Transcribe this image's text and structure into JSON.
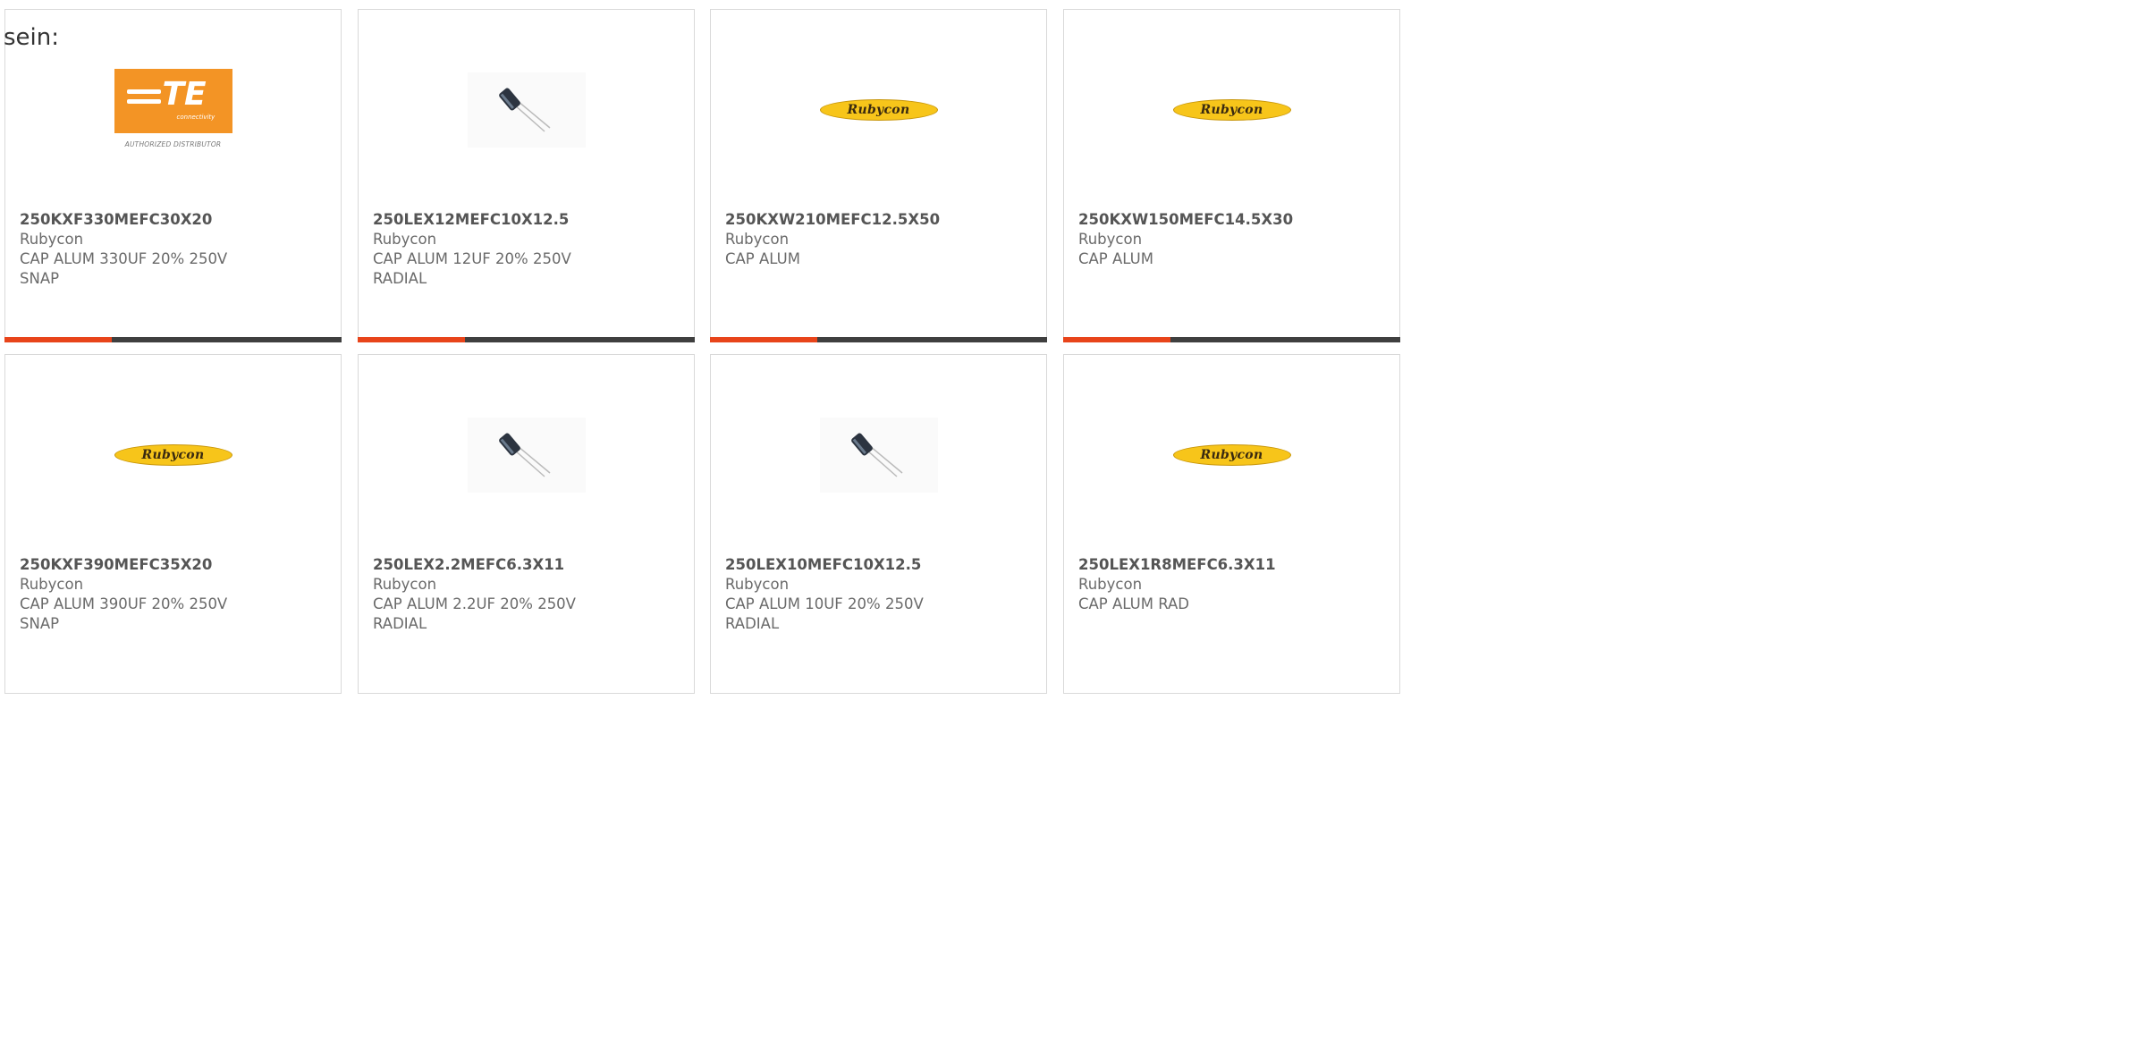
{
  "page": {
    "corner_text": "sein:"
  },
  "colors": {
    "accent": "#e8441a",
    "bar_dark": "#3f3f3f",
    "te_orange": "#f39425",
    "rubycon_yellow": "#f7c51a"
  },
  "te_logo": {
    "mark": "TE",
    "sub": "connectivity",
    "tagline": "AUTHORIZED DISTRIBUTOR"
  },
  "rubycon_logo": {
    "text": "Rubycon"
  },
  "products": [
    {
      "logo": "te-logo",
      "part": "250KXF330MEFC30X20",
      "manufacturer": "Rubycon",
      "desc_line1": "CAP ALUM 330UF 20% 250V",
      "desc_line2": "SNAP"
    },
    {
      "logo": "capacitor-image",
      "part": "250LEX12MEFC10X12.5",
      "manufacturer": "Rubycon",
      "desc_line1": "CAP ALUM 12UF 20% 250V",
      "desc_line2": "RADIAL"
    },
    {
      "logo": "rubycon-logo",
      "part": "250KXW210MEFC12.5X50",
      "manufacturer": "Rubycon",
      "desc_line1": "CAP ALUM",
      "desc_line2": ""
    },
    {
      "logo": "rubycon-logo",
      "part": "250KXW150MEFC14.5X30",
      "manufacturer": "Rubycon",
      "desc_line1": "CAP ALUM",
      "desc_line2": ""
    },
    {
      "logo": "rubycon-logo",
      "part": "250KXF390MEFC35X20",
      "manufacturer": "Rubycon",
      "desc_line1": "CAP ALUM 390UF 20% 250V",
      "desc_line2": "SNAP"
    },
    {
      "logo": "capacitor-image",
      "part": "250LEX2.2MEFC6.3X11",
      "manufacturer": "Rubycon",
      "desc_line1": "CAP ALUM 2.2UF 20% 250V",
      "desc_line2": "RADIAL"
    },
    {
      "logo": "capacitor-image",
      "part": "250LEX10MEFC10X12.5",
      "manufacturer": "Rubycon",
      "desc_line1": "CAP ALUM 10UF 20% 250V",
      "desc_line2": "RADIAL"
    },
    {
      "logo": "rubycon-logo",
      "part": "250LEX1R8MEFC6.3X11",
      "manufacturer": "Rubycon",
      "desc_line1": "CAP ALUM RAD",
      "desc_line2": ""
    }
  ]
}
